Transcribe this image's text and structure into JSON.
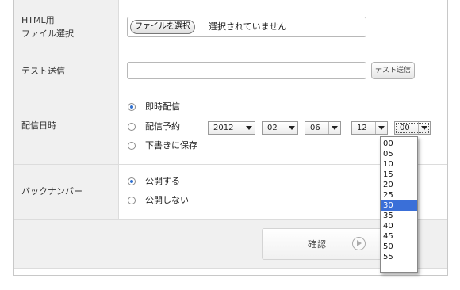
{
  "form": {
    "file": {
      "label_line1": "HTML用",
      "label_line2": "ファイル選択",
      "button_label": "ファイルを選択",
      "status_text": "選択されていません"
    },
    "test_send": {
      "label": "テスト送信",
      "input_value": "",
      "button_label": "テスト送信"
    },
    "schedule": {
      "label": "配信日時",
      "options": [
        "即時配信",
        "配信予約",
        "下書きに保存"
      ],
      "selected_option": "即時配信",
      "year": "2012",
      "month": "02",
      "day": "06",
      "hour": "12",
      "minute": "00",
      "minute_options": [
        "00",
        "05",
        "10",
        "15",
        "20",
        "25",
        "30",
        "35",
        "40",
        "45",
        "50",
        "55"
      ],
      "highlighted_minute": "30"
    },
    "backnumber": {
      "label": "バックナンバー",
      "options": [
        "公開する",
        "公開しない"
      ],
      "selected_option": "公開する"
    },
    "confirm": {
      "label": "確認",
      "icon": "play-circle-icon"
    }
  },
  "colors": {
    "label_background": "#f0f0f0",
    "radio_selected": "#2f6fcf",
    "dropdown_highlight": "#3a6fd8"
  }
}
